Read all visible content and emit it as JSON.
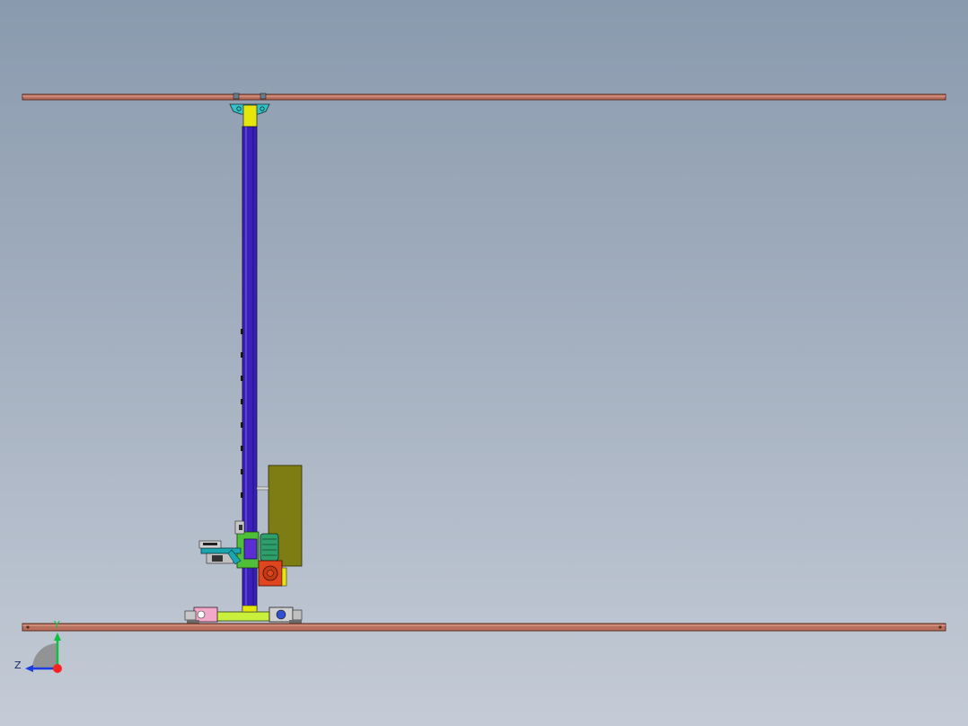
{
  "viewport": {
    "background_top": "#8a9aae",
    "background_bottom": "#c4cbd6"
  },
  "model": {
    "rail_color": "#b86f5c",
    "column_color": "#3a20b8",
    "column_cap_color": "#e6e60a",
    "cabinet_color": "#7e7d14",
    "base_color": "#c8f03c",
    "motor_color": "#2e9e6a",
    "gearbox_color": "#e0451e",
    "fork_color": "#1aa6b0",
    "carriage_color": "#4fbf3a"
  },
  "triad": {
    "x_label": "",
    "y_label": "Y",
    "z_label": "Z",
    "x_color": "#ff2020",
    "y_color": "#10c040",
    "z_color": "#1a3ce0"
  }
}
